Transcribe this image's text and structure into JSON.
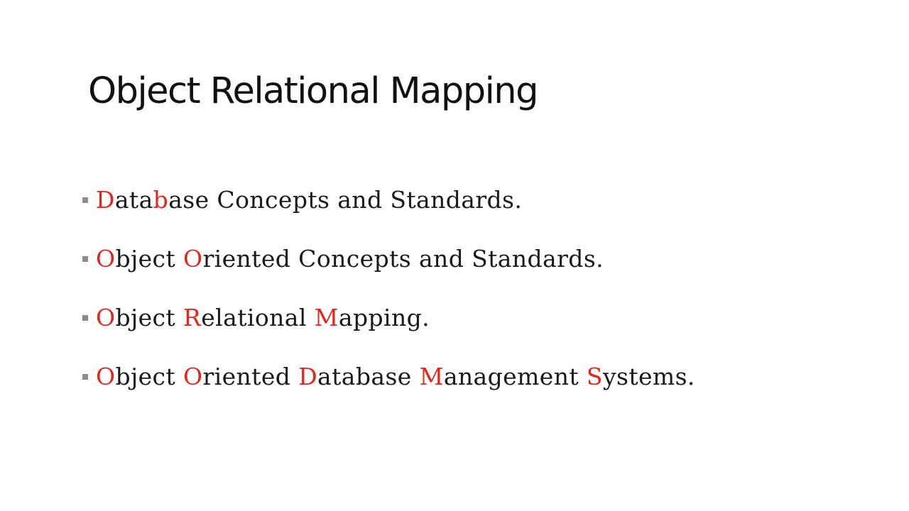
{
  "slide": {
    "title": "Object Relational Mapping",
    "accent_color": "#e3261b",
    "text_color": "#1a1a1a",
    "bullet_color": "#8c8c8c",
    "bullets": [
      {
        "segments": [
          {
            "text": "D",
            "accent": true
          },
          {
            "text": "ata",
            "accent": false
          },
          {
            "text": "b",
            "accent": true
          },
          {
            "text": "ase Concepts and Standards.",
            "accent": false
          }
        ]
      },
      {
        "segments": [
          {
            "text": "O",
            "accent": true
          },
          {
            "text": "bject ",
            "accent": false
          },
          {
            "text": "O",
            "accent": true
          },
          {
            "text": "riented Concepts and Standards.",
            "accent": false
          }
        ]
      },
      {
        "segments": [
          {
            "text": "O",
            "accent": true
          },
          {
            "text": "bject ",
            "accent": false
          },
          {
            "text": "R",
            "accent": true
          },
          {
            "text": "elational ",
            "accent": false
          },
          {
            "text": "M",
            "accent": true
          },
          {
            "text": "apping.",
            "accent": false
          }
        ]
      },
      {
        "segments": [
          {
            "text": "O",
            "accent": true
          },
          {
            "text": "bject ",
            "accent": false
          },
          {
            "text": "O",
            "accent": true
          },
          {
            "text": "riented ",
            "accent": false
          },
          {
            "text": "D",
            "accent": true
          },
          {
            "text": "atabase ",
            "accent": false
          },
          {
            "text": "M",
            "accent": true
          },
          {
            "text": "anagement ",
            "accent": false
          },
          {
            "text": "S",
            "accent": true
          },
          {
            "text": "ystems.",
            "accent": false
          }
        ]
      }
    ]
  }
}
